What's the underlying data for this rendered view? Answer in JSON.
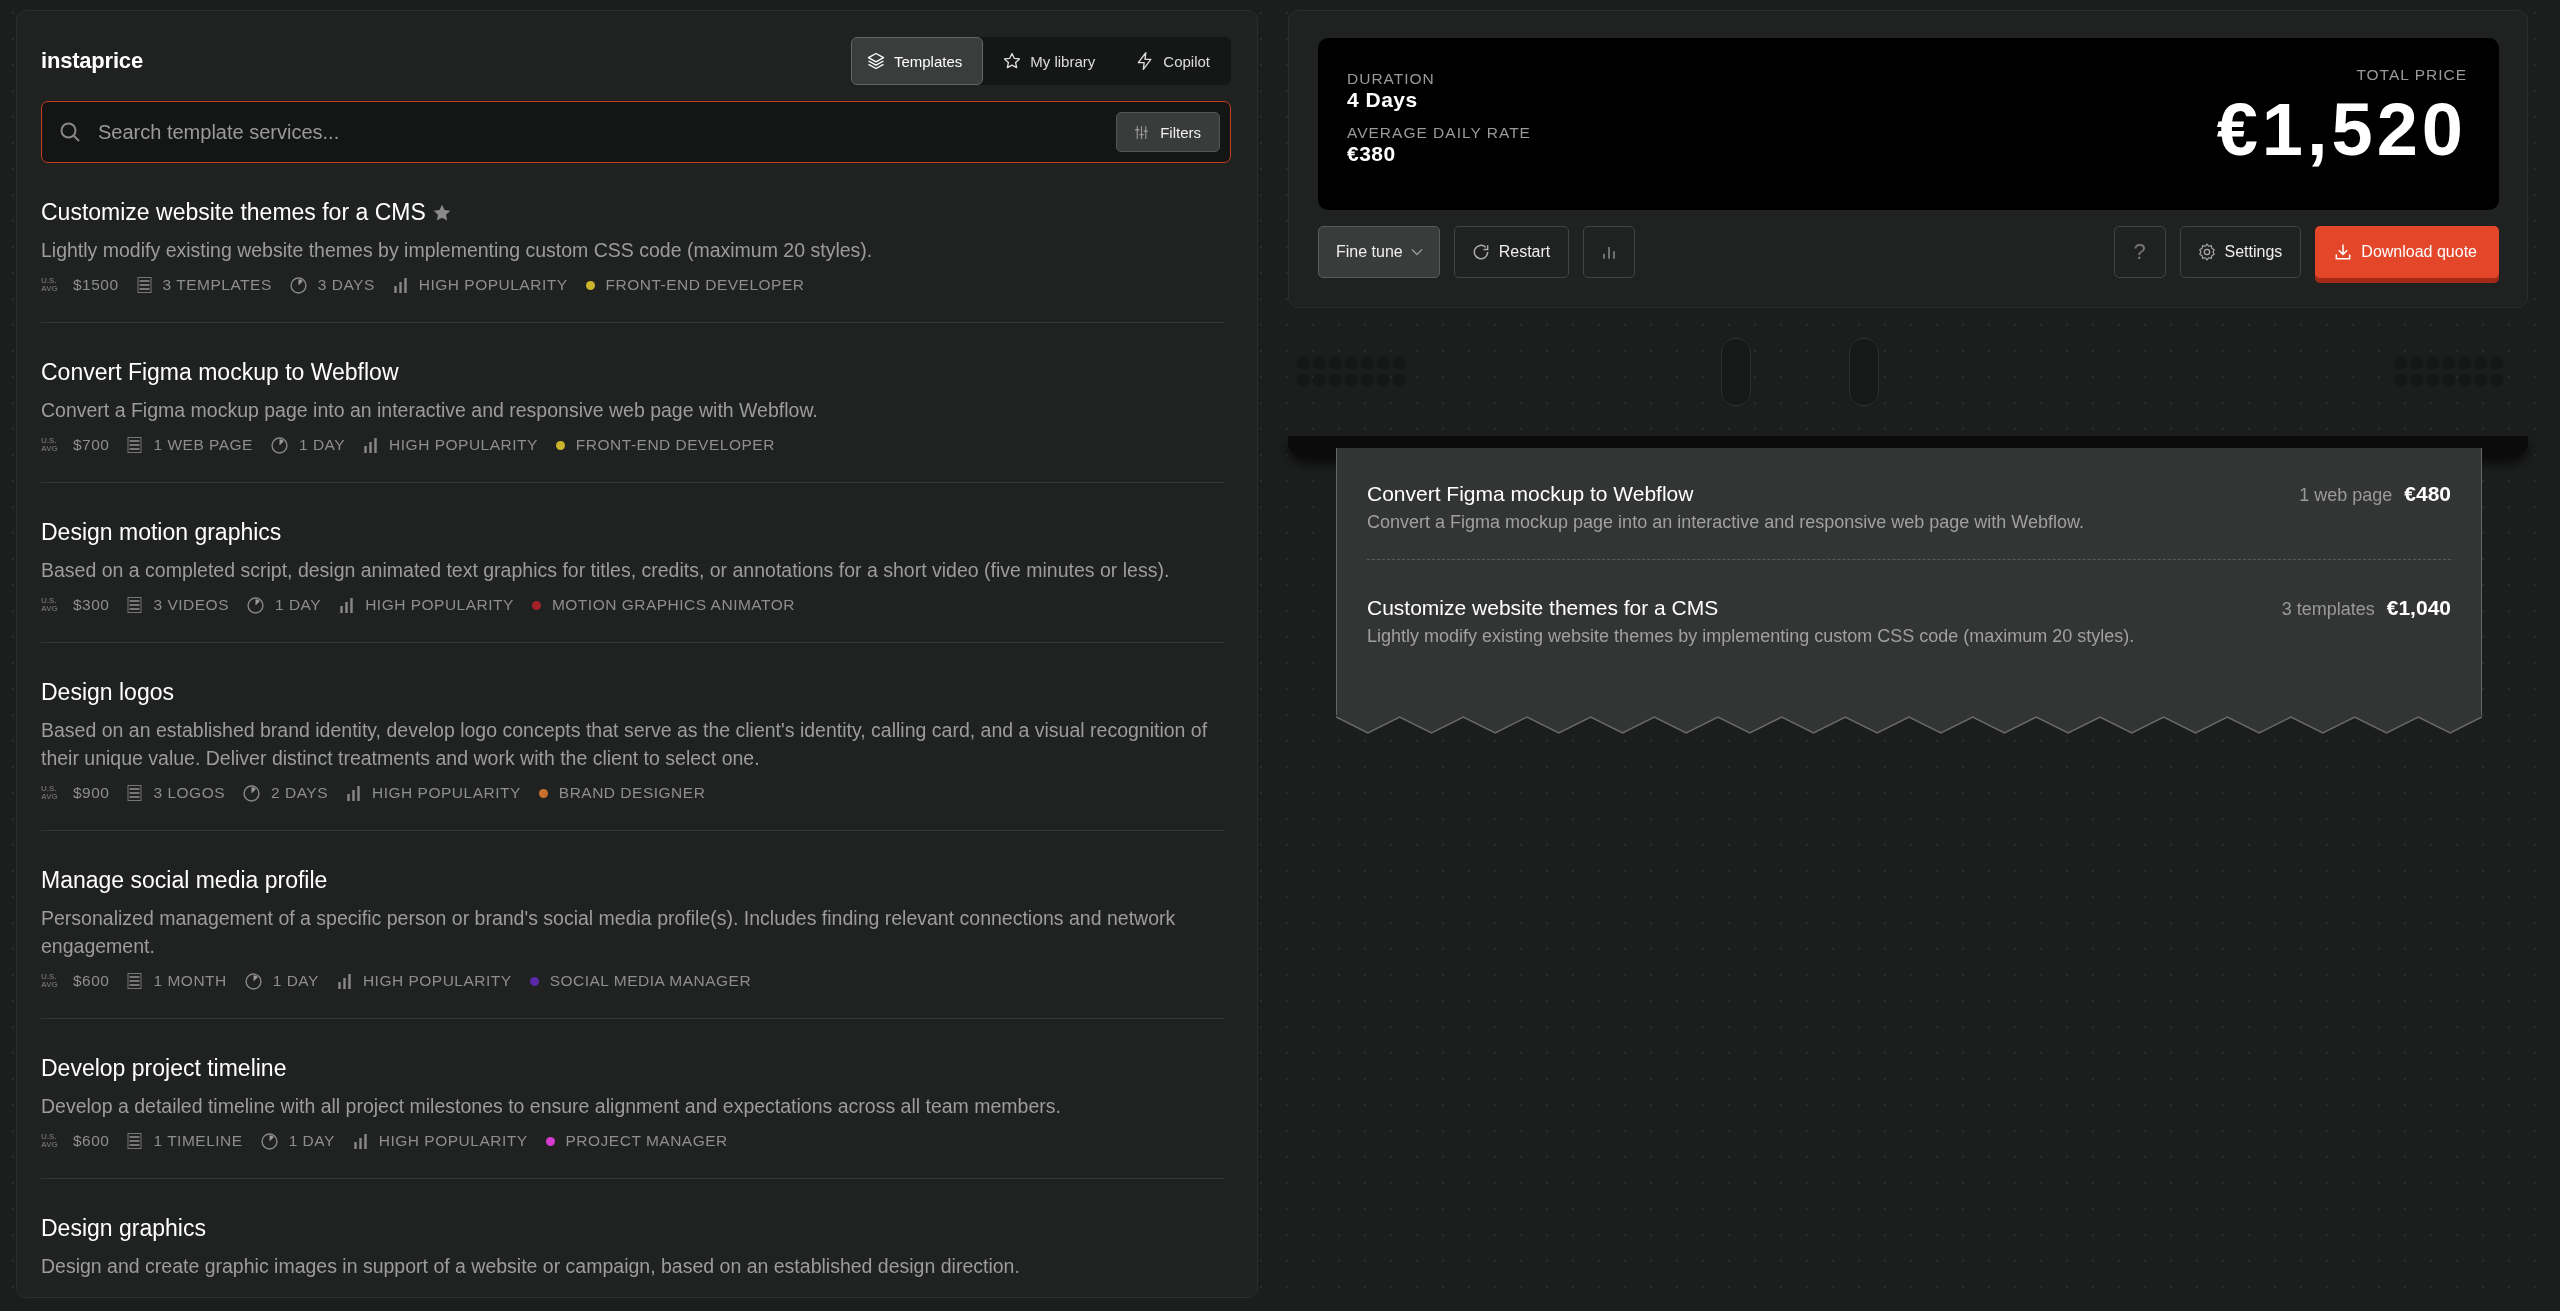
{
  "brand": {
    "name": "instaprice"
  },
  "tabs": [
    {
      "label": "Templates",
      "selected": true
    },
    {
      "label": "My library",
      "selected": false
    },
    {
      "label": "Copilot",
      "selected": false
    }
  ],
  "search": {
    "placeholder": "Search template services...",
    "filter_button": "Filters"
  },
  "templates": [
    {
      "title": "Customize website themes for a CMS",
      "starred": true,
      "description": "Lightly modify existing website themes by implementing custom CSS code (maximum 20 styles).",
      "price_label": "U.S. AVG",
      "price": "$1500",
      "deliverable": "3 TEMPLATES",
      "duration": "3 DAYS",
      "popularity": "HIGH POPULARITY",
      "role": "FRONT-END DEVELOPER",
      "color": "#c9b42c"
    },
    {
      "title": "Convert Figma mockup to Webflow",
      "starred": false,
      "description": "Convert a Figma mockup page into an interactive and responsive web page with Webflow.",
      "price_label": "U.S. AVG",
      "price": "$700",
      "deliverable": "1 WEB PAGE",
      "duration": "1 DAY",
      "popularity": "HIGH POPULARITY",
      "role": "FRONT-END DEVELOPER",
      "color": "#c9b42c"
    },
    {
      "title": "Design motion graphics",
      "starred": false,
      "description": "Based on a completed script, design animated text graphics for titles, credits, or annotations for a short video (five minutes or less).",
      "price_label": "U.S. AVG",
      "price": "$300",
      "deliverable": "3 VIDEOS",
      "duration": "1 DAY",
      "popularity": "HIGH POPULARITY",
      "role": "MOTION GRAPHICS ANIMATOR",
      "color": "#a3222a"
    },
    {
      "title": "Design logos",
      "starred": false,
      "description": "Based on an established brand identity, develop logo concepts that serve as the client's identity, calling card, and a visual recognition of their unique value. Deliver distinct treatments and work with the client to select one.",
      "price_label": "U.S. AVG",
      "price": "$900",
      "deliverable": "3 LOGOS",
      "duration": "2 DAYS",
      "popularity": "HIGH POPULARITY",
      "role": "BRAND DESIGNER",
      "color": "#c8702c"
    },
    {
      "title": "Manage social media profile",
      "starred": false,
      "description": "Personalized management of a specific person or brand's social media profile(s). Includes finding relevant connections and network engagement.",
      "price_label": "U.S. AVG",
      "price": "$600",
      "deliverable": "1 MONTH",
      "duration": "1 DAY",
      "popularity": "HIGH POPULARITY",
      "role": "SOCIAL MEDIA MANAGER",
      "color": "#5b2aa8"
    },
    {
      "title": "Develop project timeline",
      "starred": false,
      "description": "Develop a detailed timeline with all project milestones to ensure alignment and expectations across all team members.",
      "price_label": "U.S. AVG",
      "price": "$600",
      "deliverable": "1 TIMELINE",
      "duration": "1 DAY",
      "popularity": "HIGH POPULARITY",
      "role": "PROJECT MANAGER",
      "color": "#d63bd0"
    },
    {
      "title": "Design graphics",
      "starred": false,
      "description": "Design and create graphic images in support of a website or campaign, based on an established design direction."
    }
  ],
  "summary": {
    "duration_label": "DURATION",
    "duration": "4 Days",
    "rate_label": "AVERAGE DAILY RATE",
    "rate": "€380",
    "total_label": "TOTAL PRICE",
    "total": "€1,520"
  },
  "actions": [
    {
      "kind": "dropdown",
      "label": "Fine tune"
    },
    {
      "kind": "restart",
      "label": "Restart"
    },
    {
      "kind": "chart"
    },
    {
      "kind": "spacer"
    },
    {
      "kind": "help",
      "label": "?"
    },
    {
      "kind": "settings",
      "label": "Settings"
    },
    {
      "kind": "download",
      "label": "Download quote"
    }
  ],
  "receipt": [
    {
      "title": "Convert Figma mockup to Webflow",
      "description": "Convert a Figma mockup page into an interactive and responsive web page with Webflow.",
      "quantity": "1 web page",
      "price": "€480"
    },
    {
      "title": "Customize website themes for a CMS",
      "description": "Lightly modify existing website themes by implementing custom CSS code (maximum 20 styles).",
      "quantity": "3 templates",
      "price": "€1,040"
    }
  ]
}
